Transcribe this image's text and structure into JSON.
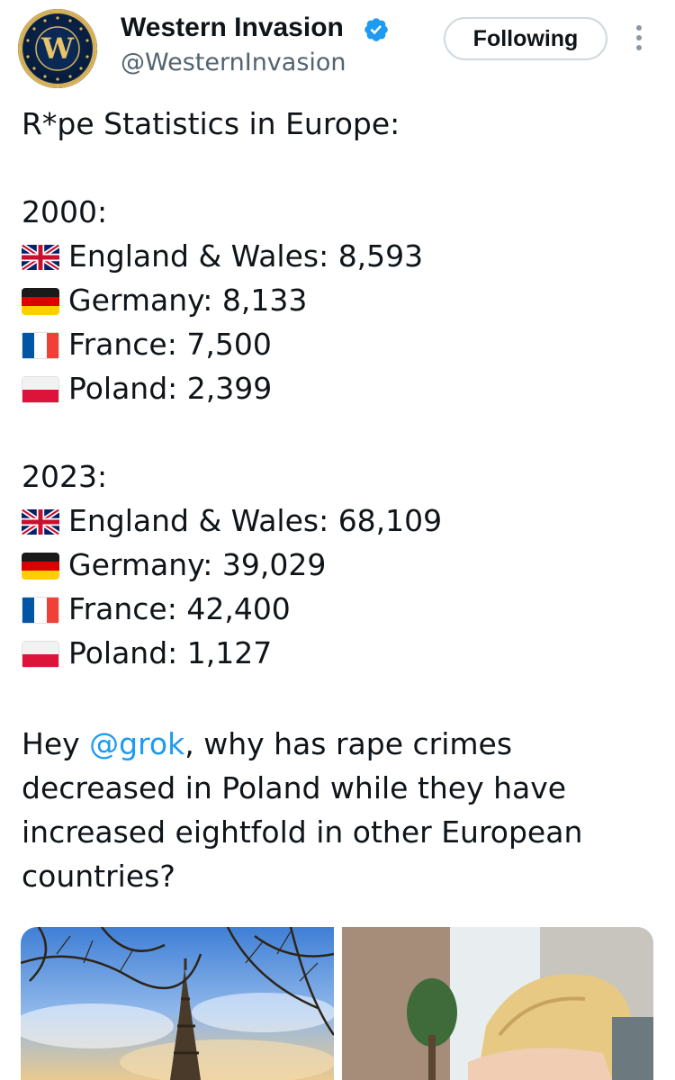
{
  "author": {
    "display_name": "Western Invasion",
    "handle": "@WesternInvasion",
    "avatar_letter": "W",
    "avatar_icon": "gold-w-crest",
    "verified_icon": "blue-verified-badge",
    "verified_color": "#1d9bf0"
  },
  "follow_button": {
    "label": "Following"
  },
  "more_icon": "vertical-ellipsis-icon",
  "tweet": {
    "title": "R*pe Statistics in Europe:",
    "section_2000": {
      "year": "2000:",
      "rows": [
        {
          "flag": "uk-flag-icon",
          "text": "England & Wales: 8,593"
        },
        {
          "flag": "germany-flag-icon",
          "text": "Germany: 8,133"
        },
        {
          "flag": "france-flag-icon",
          "text": "France: 7,500"
        },
        {
          "flag": "poland-flag-icon",
          "text": "Poland: 2,399"
        }
      ]
    },
    "section_2023": {
      "year": "2023:",
      "rows": [
        {
          "flag": "uk-flag-icon",
          "text": "England & Wales: 68,109"
        },
        {
          "flag": "germany-flag-icon",
          "text": "Germany: 39,029"
        },
        {
          "flag": "france-flag-icon",
          "text": "France: 42,400"
        },
        {
          "flag": "poland-flag-icon",
          "text": "Poland: 1,127"
        }
      ]
    },
    "question": {
      "line1_before": "Hey ",
      "mention": "@grok",
      "line1_after": ", why has rape crimes",
      "line2": "decreased in Poland while they have",
      "line3": "increased eightfold in other European",
      "line4": "countries?"
    },
    "mention_color": "#1d9bf0"
  },
  "media": [
    {
      "name": "eiffel-tower-photo"
    },
    {
      "name": "distressed-woman-photo"
    }
  ]
}
